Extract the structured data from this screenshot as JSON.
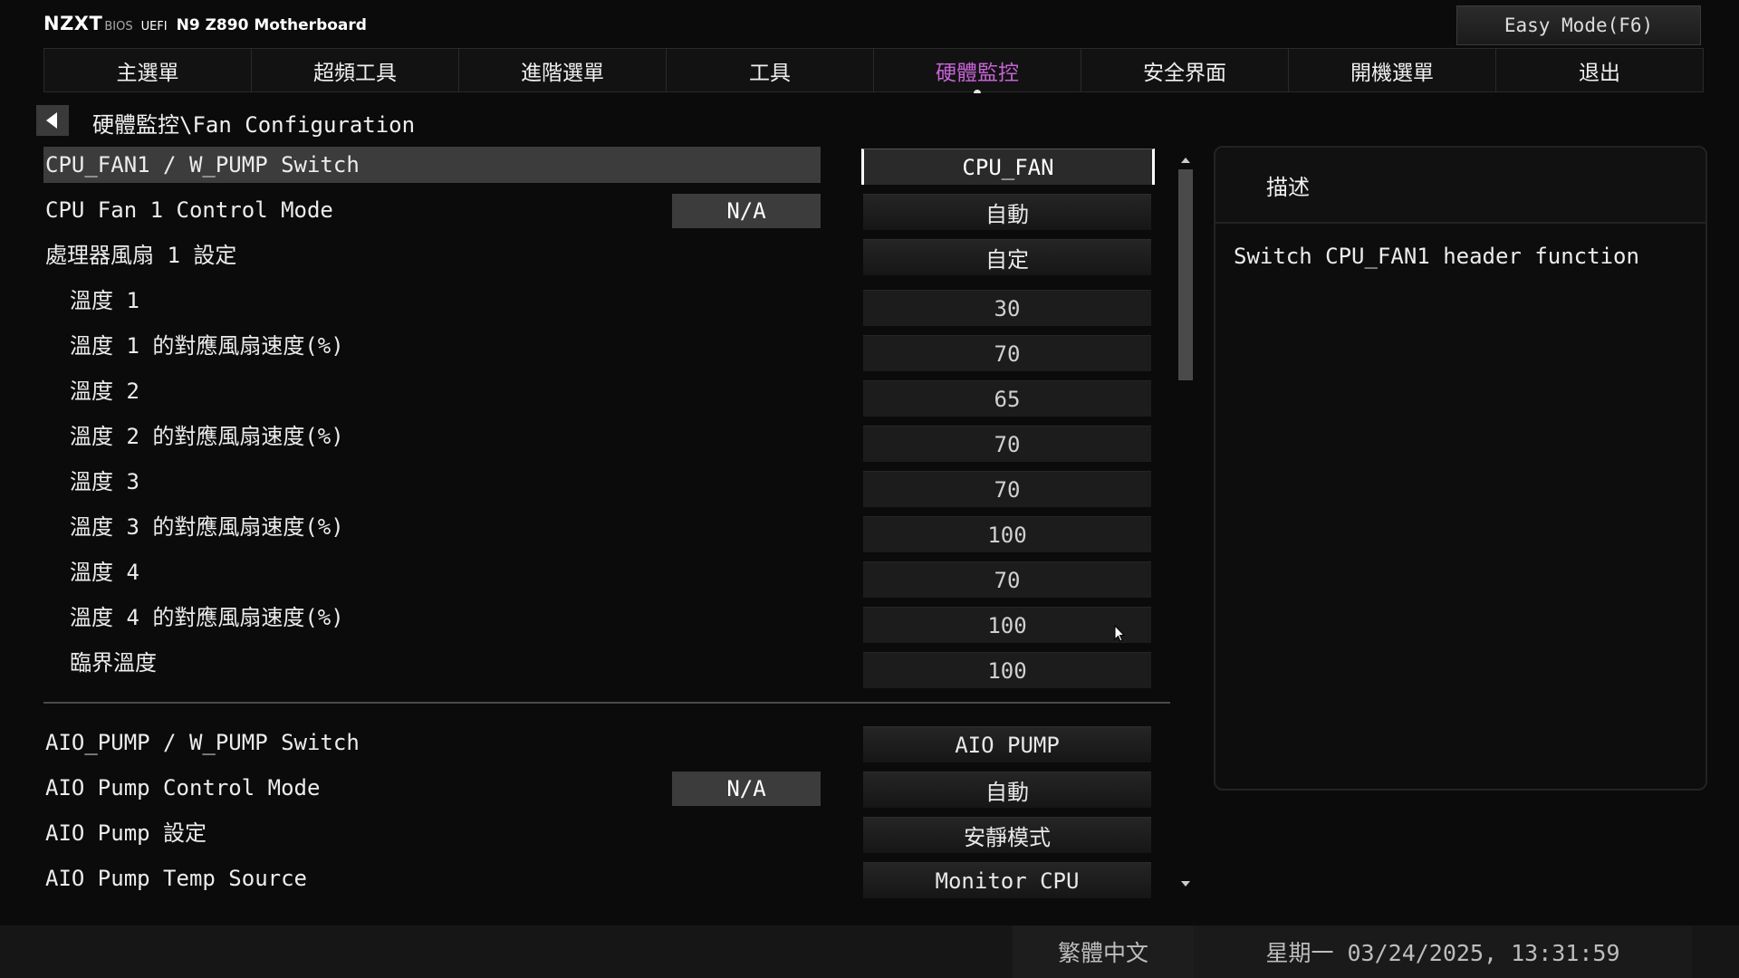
{
  "header": {
    "brand": "NZXT",
    "bios_label": "BIOS",
    "uefi_label": "UEFI",
    "model": "N9 Z890 Motherboard",
    "easy_mode_label": "Easy Mode(F6)"
  },
  "tabs": [
    {
      "label": "主選單"
    },
    {
      "label": "超頻工具"
    },
    {
      "label": "進階選單"
    },
    {
      "label": "工具"
    },
    {
      "label": "硬體監控",
      "active": true
    },
    {
      "label": "安全界面"
    },
    {
      "label": "開機選單"
    },
    {
      "label": "退出"
    }
  ],
  "breadcrumb": "硬體監控\\Fan Configuration",
  "settings": [
    {
      "label": "CPU_FAN1 / W_PUMP Switch",
      "value": "CPU_FAN",
      "selected": true
    },
    {
      "label": "CPU Fan 1 Control Mode",
      "status": "N/A",
      "value": "自動"
    },
    {
      "label": "處理器風扇 1 設定",
      "value": "自定"
    },
    {
      "label": "溫度 1",
      "value": "30"
    },
    {
      "label": "溫度 1 的對應風扇速度(%)",
      "value": "70"
    },
    {
      "label": "溫度 2",
      "value": "65"
    },
    {
      "label": "溫度 2 的對應風扇速度(%)",
      "value": "70"
    },
    {
      "label": "溫度 3",
      "value": "70"
    },
    {
      "label": "溫度 3 的對應風扇速度(%)",
      "value": "100"
    },
    {
      "label": "溫度 4",
      "value": "70"
    },
    {
      "label": "溫度 4 的對應風扇速度(%)",
      "value": "100"
    },
    {
      "label": "臨界溫度",
      "value": "100"
    },
    {
      "label": "AIO_PUMP / W_PUMP Switch",
      "value": "AIO PUMP"
    },
    {
      "label": "AIO Pump Control Mode",
      "status": "N/A",
      "value": "自動"
    },
    {
      "label": "AIO Pump 設定",
      "value": "安靜模式"
    },
    {
      "label": "AIO Pump Temp Source",
      "value": "Monitor CPU"
    }
  ],
  "description": {
    "title": "描述",
    "text": "Switch CPU_FAN1 header function"
  },
  "footer": {
    "language": "繁體中文",
    "datetime": "星期一 03/24/2025, 13:31:59"
  },
  "colors": {
    "active_tab": "#c663d6",
    "background": "#0b0b0b",
    "highlight_row": "#3c3c3c"
  }
}
